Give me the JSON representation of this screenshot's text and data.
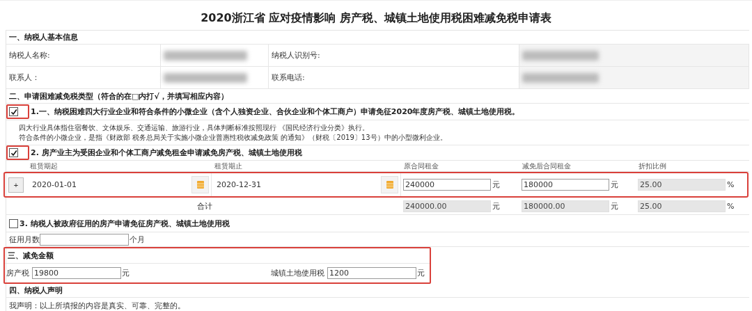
{
  "title": "2020浙江省 应对疫情影响 房产税、城镇土地使用税困难减免税申请表",
  "basic_info": {
    "heading": "一、纳税人基本信息",
    "fields": [
      {
        "label": "纳税人名称:",
        "redacted": true
      },
      {
        "label": "纳税人识别号:",
        "redacted": true
      },
      {
        "label": "联系人：",
        "redacted": true
      },
      {
        "label": "联系电话:",
        "redacted": true
      }
    ]
  },
  "relief_types": {
    "heading": "二、申请困难减免税类型（符合的在□内打√，并填写相应内容）",
    "items": [
      {
        "kind": "notice",
        "checked": true,
        "highlighted": true,
        "label": "1.一、纳税困难四大行业企业和符合条件的小微企业（含个人独资企业、合伙企业和个体工商户）申请免征2020年度房产税、城镇土地使用税。",
        "notes": [
          "四大行业具体指住宿餐饮、文体娱乐、交通运输、旅游行业，具体判断标准按照现行 《国民经济行业分类》执行。",
          "符合条件的小微企业，是指《财政部 税务总局关于实施小微企业普惠性税收减免政策 的通知》（财税〔2019〕13号）中的小型微利企业。"
        ]
      },
      {
        "kind": "lease",
        "checked": true,
        "highlighted": true,
        "label": "2. 房产业主为受困企业和个体工商户减免租金申请减免房产税、城镇土地使用税",
        "columns": [
          "租赁期起",
          "租赁期止",
          "原合同租金",
          "减免后合同租金",
          "折扣比例"
        ],
        "rows": [
          {
            "highlighted": true,
            "add_button": "+",
            "start": "2020-01-01",
            "end": "2020-12-31",
            "amounts": [
              {
                "value": "240000",
                "unit": "元",
                "disabled": false
              },
              {
                "value": "180000",
                "unit": "元",
                "disabled": false
              },
              {
                "value": "25.00",
                "unit": "%",
                "disabled": true
              }
            ]
          }
        ],
        "total": {
          "label": "合计",
          "amounts": [
            {
              "value": "240000.00",
              "unit": "元",
              "disabled": true
            },
            {
              "value": "180000.00",
              "unit": "元",
              "disabled": true
            },
            {
              "value": "25.00",
              "unit": "%",
              "disabled": true
            }
          ]
        }
      },
      {
        "kind": "requisition",
        "checked": false,
        "highlighted": false,
        "label": "3. 纳税人被政府征用的房产申请免征房产税、城镇土地使用税",
        "field_label": "征用月数",
        "unit": "个月"
      }
    ]
  },
  "relief_amount": {
    "heading": "三、减免金额",
    "highlighted": true,
    "fields": [
      {
        "label": "房产税",
        "value": "19800",
        "unit": "元"
      },
      {
        "label": "城镇土地使用税",
        "value": "1200",
        "unit": "元"
      }
    ]
  },
  "declaration": {
    "heading": "四、纳税人声明",
    "text": "我声明：以上所填报的内容是真实、可靠、完整的。"
  }
}
